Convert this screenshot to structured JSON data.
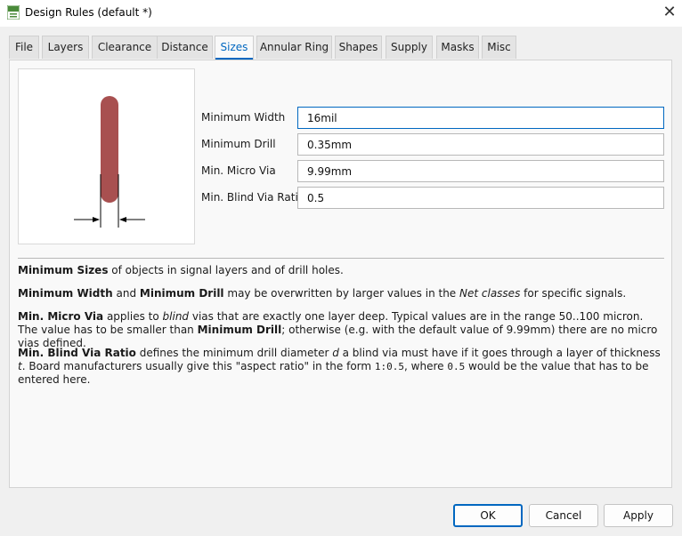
{
  "window": {
    "title": "Design Rules (default *)",
    "close_glyph": "✕",
    "app_icon": "brd-icon"
  },
  "tabs": [
    {
      "label": "File"
    },
    {
      "label": "Layers"
    },
    {
      "label": "Clearance"
    },
    {
      "label": "Distance"
    },
    {
      "label": "Sizes",
      "active": true
    },
    {
      "label": "Annular Ring"
    },
    {
      "label": "Shapes"
    },
    {
      "label": "Supply"
    },
    {
      "label": "Masks"
    },
    {
      "label": "Misc"
    }
  ],
  "fields": [
    {
      "label": "Minimum Width",
      "value": "16mil"
    },
    {
      "label": "Minimum Drill",
      "value": "0.35mm"
    },
    {
      "label": "Min. Micro Via",
      "value": "9.99mm"
    },
    {
      "label": "Min. Blind Via Ratio",
      "value": "0.5"
    }
  ],
  "help": {
    "p1": {
      "b1": "Minimum Sizes",
      "t1": " of objects in signal layers and of drill holes."
    },
    "p2": {
      "b1": "Minimum Width",
      "t1": " and ",
      "b2": "Minimum Drill",
      "t2": " may be overwritten by larger values in the ",
      "i1": "Net classes",
      "t3": " for specific signals."
    },
    "p3": {
      "b1": "Min. Micro Via",
      "t1": " applies to ",
      "i1": "blind",
      "t2": " vias that are exactly one layer deep. Typical values are in the range 50..100 micron. The value has to be smaller than ",
      "b2": "Minimum Drill",
      "t3": "; otherwise (e.g. with the default value of 9.99mm) there are no micro vias defined."
    },
    "p4": {
      "b1": "Min. Blind Via Ratio",
      "t1": " defines the minimum drill diameter ",
      "i1": "d",
      "t2": " a blind via must have if it goes through a layer of thickness ",
      "i2": "t",
      "t3": ". Board manufacturers usually give this \"aspect ratio\" in the form ",
      "m1": "1:0.5",
      "t4": ", where ",
      "m2": "0.5",
      "t5": " would be the value that has to be entered here."
    }
  },
  "buttons": {
    "ok": "OK",
    "cancel": "Cancel",
    "apply": "Apply"
  },
  "colors": {
    "accent": "#0067c0",
    "track": "#a85050"
  }
}
